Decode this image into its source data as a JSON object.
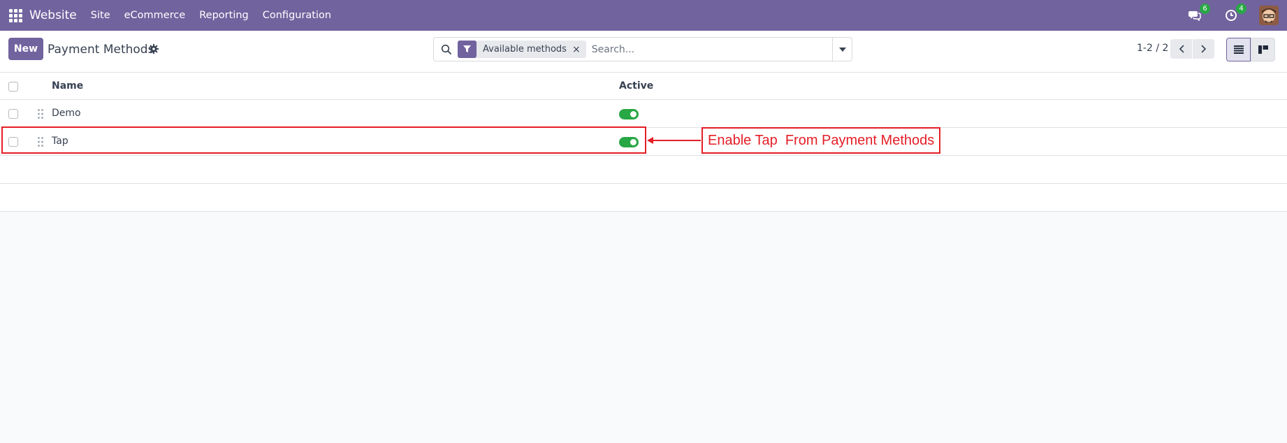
{
  "navbar": {
    "brand": "Website",
    "menu": [
      "Site",
      "eCommerce",
      "Reporting",
      "Configuration"
    ],
    "messages_count": "6",
    "activities_count": "4",
    "color": "#71639e"
  },
  "control_panel": {
    "new_button": "New",
    "title": "Payment Methods",
    "search": {
      "facet": "Available methods",
      "facet_close": "×",
      "placeholder": "Search..."
    },
    "pager": "1-2 / 2"
  },
  "list": {
    "columns": {
      "name": "Name",
      "active": "Active"
    },
    "rows": [
      {
        "name": "Demo",
        "active": true
      },
      {
        "name": "Tap",
        "active": true
      }
    ]
  },
  "annotation": {
    "text": "Enable Tap  From Payment Methods",
    "color": "#e41e26"
  },
  "icons": [
    "apps-icon",
    "messages-icon",
    "activity-clock-icon",
    "gear-icon",
    "search-icon",
    "filter-icon",
    "caret-down-icon",
    "chevron-left-icon",
    "chevron-right-icon",
    "list-view-icon",
    "kanban-view-icon",
    "drag-handle-icon"
  ]
}
